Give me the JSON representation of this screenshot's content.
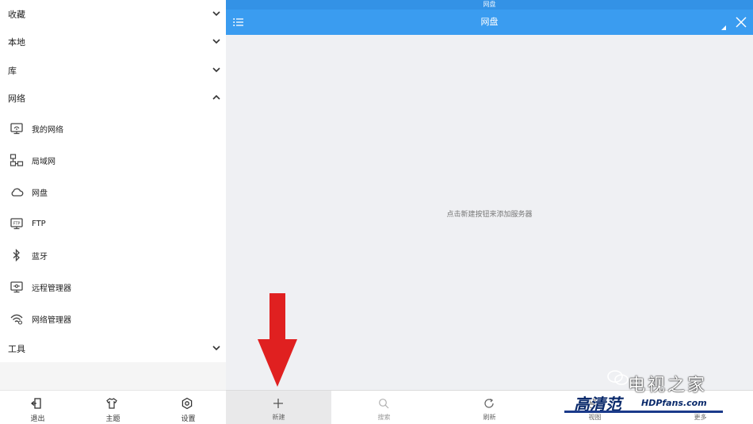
{
  "sidebar": {
    "sections": [
      {
        "label": "收藏",
        "expanded": false
      },
      {
        "label": "本地",
        "expanded": false
      },
      {
        "label": "库",
        "expanded": false
      },
      {
        "label": "网络",
        "expanded": true
      },
      {
        "label": "工具",
        "expanded": false
      }
    ],
    "network_items": [
      {
        "label": "我的网络",
        "icon": "monitor-network-icon"
      },
      {
        "label": "局域网",
        "icon": "lan-icon"
      },
      {
        "label": "网盘",
        "icon": "cloud-icon"
      },
      {
        "label": "FTP",
        "icon": "ftp-icon"
      },
      {
        "label": "蓝牙",
        "icon": "bluetooth-icon"
      },
      {
        "label": "远程管理器",
        "icon": "remote-manager-icon"
      },
      {
        "label": "网络管理器",
        "icon": "wifi-manager-icon"
      }
    ],
    "bottom": [
      {
        "label": "退出",
        "icon": "exit-icon"
      },
      {
        "label": "主题",
        "icon": "shirt-icon"
      },
      {
        "label": "设置",
        "icon": "gear-icon"
      }
    ]
  },
  "main": {
    "statusbar_title": "网盘",
    "title": "网盘",
    "empty_message": "点击新建按钮来添加服务器",
    "toolbar": [
      {
        "label": "新建",
        "icon": "plus-icon"
      },
      {
        "label": "搜索",
        "icon": "search-icon"
      },
      {
        "label": "刷新",
        "icon": "refresh-icon"
      },
      {
        "label": "视图",
        "icon": "view-icon"
      },
      {
        "label": "更多",
        "icon": "more-icon"
      }
    ]
  },
  "watermark": {
    "top_text": "电视之家",
    "logo_text": "高清范",
    "logo_url_text": "HDPfans.com"
  },
  "colors": {
    "accent": "#3a9cf0",
    "statusbar": "#3392e6",
    "arrow": "#e02020"
  }
}
